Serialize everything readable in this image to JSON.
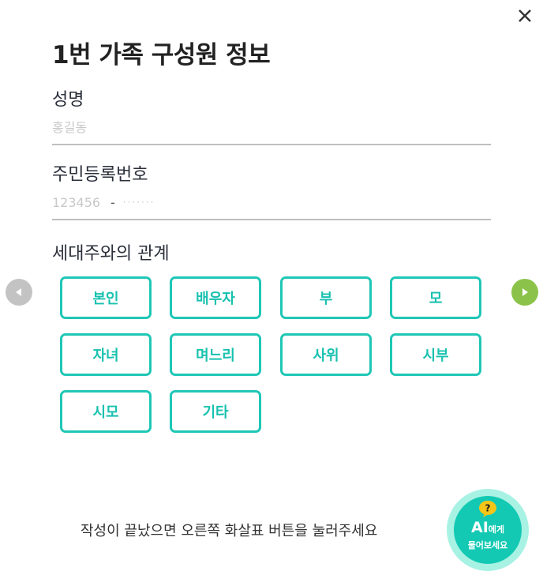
{
  "modal": {
    "title": "1번 가족 구성원 정보"
  },
  "name_field": {
    "label": "성명",
    "placeholder": "홍길동",
    "value": ""
  },
  "resident_id": {
    "label": "주민등록번호",
    "front_placeholder": "123456",
    "separator": "-",
    "back_placeholder": "·······"
  },
  "relation": {
    "label": "세대주와의 관계",
    "options": [
      "본인",
      "배우자",
      "부",
      "모",
      "자녀",
      "며느리",
      "사위",
      "시부",
      "시모",
      "기타"
    ]
  },
  "footer": {
    "hint": "작성이 끝났으면 오른쪽 화살표 버튼을 눌러주세요"
  },
  "ai_button": {
    "question_mark": "?",
    "line1_big": "AI",
    "line1_small": "에게",
    "line2": "물어보세요"
  },
  "colors": {
    "accent": "#1fc7b6",
    "next_arrow": "#8bc34a",
    "prev_arrow": "#c3c3c3",
    "ai_badge": "#13c9b3",
    "ai_question": "#f5c518"
  },
  "icons": {
    "close": "close-icon",
    "prev": "arrow-left-icon",
    "next": "arrow-right-icon",
    "question": "question-bubble-icon"
  }
}
